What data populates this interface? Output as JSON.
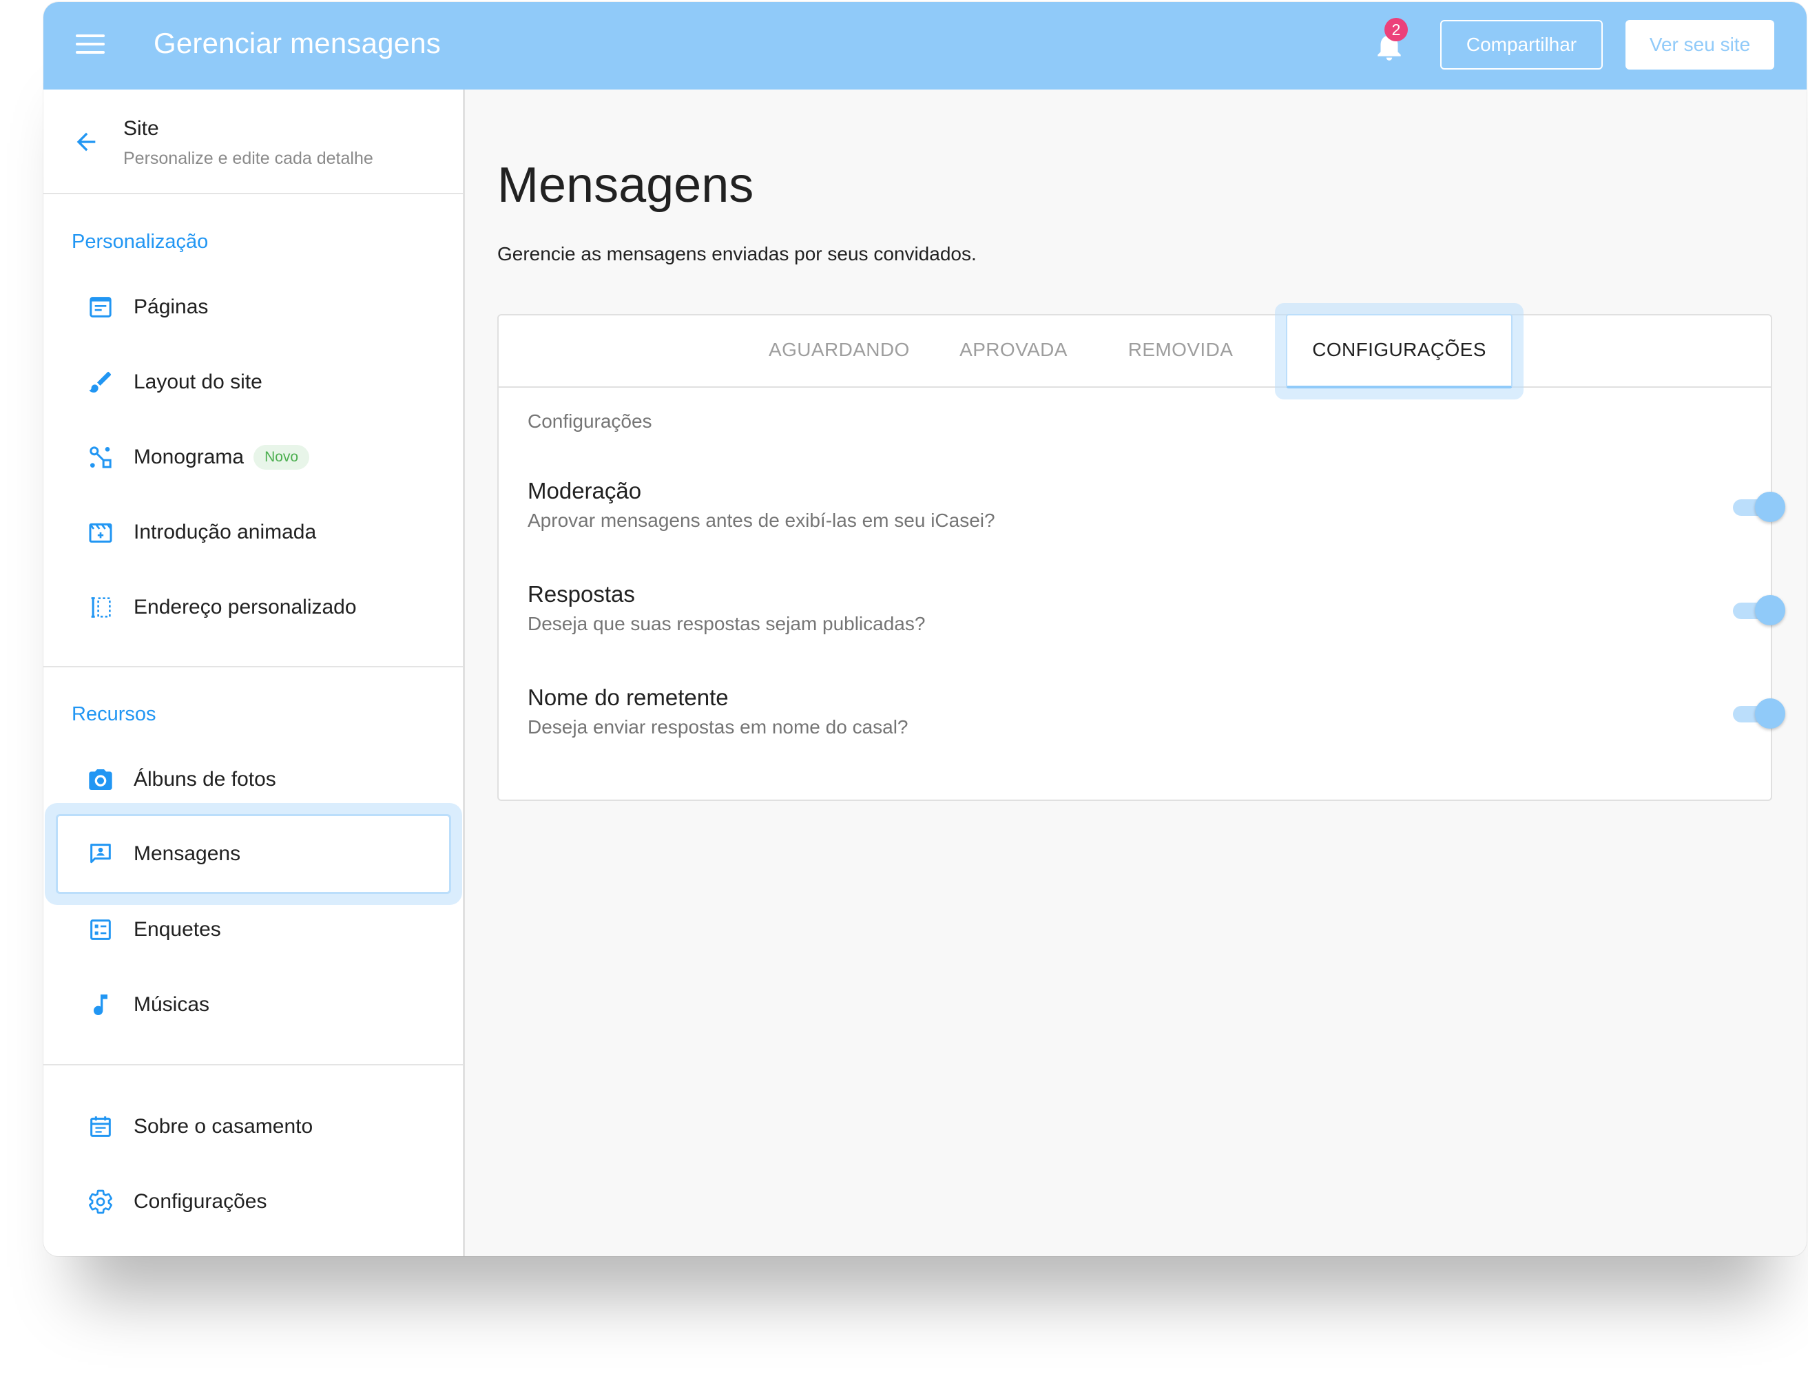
{
  "header": {
    "title": "Gerenciar mensagens",
    "notification_count": "2",
    "share_label": "Compartilhar",
    "view_site_label": "Ver seu site"
  },
  "sidebar": {
    "site_title": "Site",
    "site_subtitle": "Personalize e edite cada detalhe",
    "personalizacao": {
      "label": "Personalização",
      "items": [
        {
          "label": "Páginas",
          "icon": "page-icon"
        },
        {
          "label": "Layout do site",
          "icon": "brush-icon"
        },
        {
          "label": "Monograma",
          "icon": "monogram-icon",
          "badge": "Novo"
        },
        {
          "label": "Introdução animada",
          "icon": "film-icon"
        },
        {
          "label": "Endereço personalizado",
          "icon": "custom-address-icon"
        }
      ]
    },
    "recursos": {
      "label": "Recursos",
      "items": [
        {
          "label": "Álbuns de fotos",
          "icon": "camera-icon"
        },
        {
          "label": "Mensagens",
          "icon": "message-icon",
          "active": true
        },
        {
          "label": "Enquetes",
          "icon": "poll-icon"
        },
        {
          "label": "Músicas",
          "icon": "music-note-icon"
        }
      ]
    },
    "bottom_items": [
      {
        "label": "Sobre o casamento",
        "icon": "calendar-icon"
      },
      {
        "label": "Configurações",
        "icon": "gear-icon"
      }
    ]
  },
  "main": {
    "title": "Mensagens",
    "description": "Gerencie as mensagens enviadas por seus convidados.",
    "tabs": [
      {
        "label": "AGUARDANDO"
      },
      {
        "label": "APROVADA"
      },
      {
        "label": "REMOVIDA"
      },
      {
        "label": "CONFIGURAÇÕES",
        "active": true
      }
    ],
    "settings_heading": "Configurações",
    "settings": [
      {
        "title": "Moderação",
        "description": "Aprovar mensagens antes de exibí-las em seu iCasei?",
        "enabled": true
      },
      {
        "title": "Respostas",
        "description": "Deseja que suas respostas sejam publicadas?",
        "enabled": true
      },
      {
        "title": "Nome do remetente",
        "description": "Deseja enviar respostas em nome do casal?",
        "enabled": true
      }
    ]
  },
  "colors": {
    "header_bg": "#90caf9",
    "accent": "#2196f3",
    "toggle_on": "#90caf9",
    "badge_pink": "#ec407a",
    "novo_green": "#4caf50"
  }
}
